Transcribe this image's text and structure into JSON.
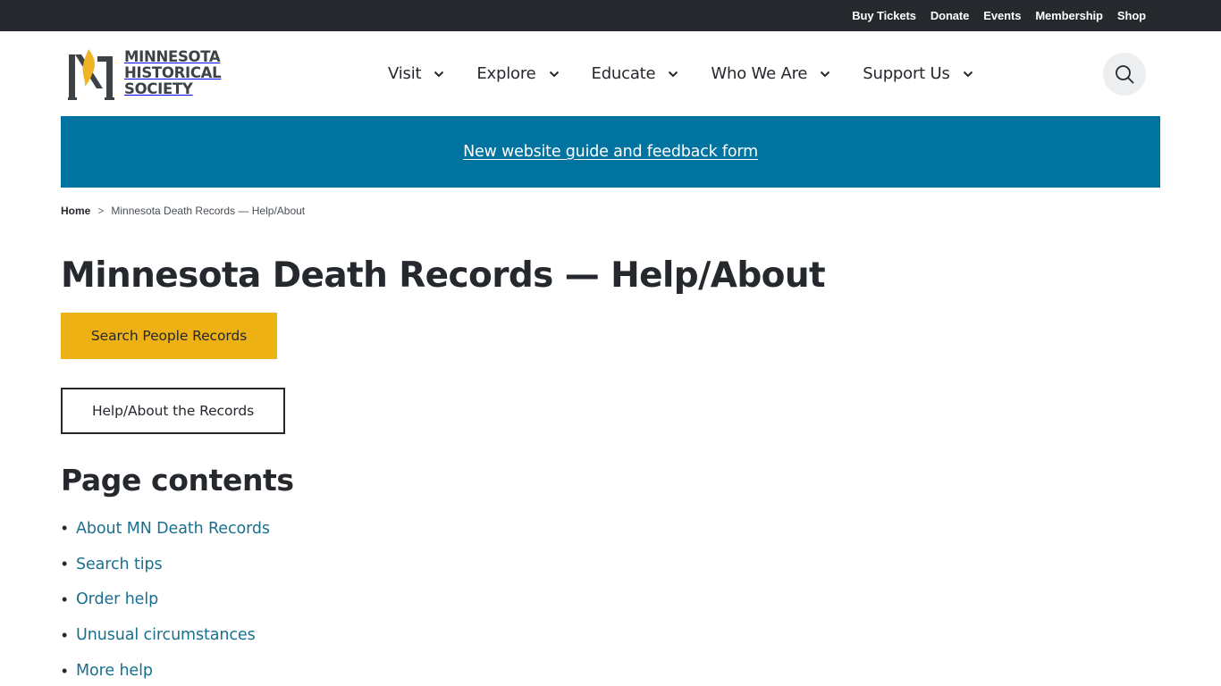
{
  "utility_nav": [
    "Buy Tickets",
    "Donate",
    "Events",
    "Membership",
    "Shop"
  ],
  "logo": {
    "lines": [
      "MINNESOTA",
      "HISTORICAL",
      "SOCIETY"
    ],
    "colors": {
      "flame": "#f0b323",
      "mark": "#3d4247"
    }
  },
  "main_nav": [
    {
      "label": "Visit"
    },
    {
      "label": "Explore"
    },
    {
      "label": "Educate"
    },
    {
      "label": "Who We Are"
    },
    {
      "label": "Support Us"
    }
  ],
  "search": {
    "icon": "search-icon"
  },
  "banner": {
    "link_text": "New website guide and feedback form",
    "color": "#0073a0"
  },
  "breadcrumb": {
    "home": "Home",
    "separator": ">",
    "current": "Minnesota Death Records — Help/About"
  },
  "page": {
    "title": "Minnesota Death Records — Help/About",
    "primary_button": "Search People Records",
    "secondary_button": "Help/About the Records",
    "contents_heading": "Page contents",
    "contents": [
      "About MN Death Records",
      "Search tips",
      "Order help",
      "Unusual circumstances",
      "More help"
    ]
  },
  "colors": {
    "top_bar": "#25282d",
    "accent_gold": "#eeb114",
    "link": "#1a6f8f",
    "text": "#25282d"
  }
}
